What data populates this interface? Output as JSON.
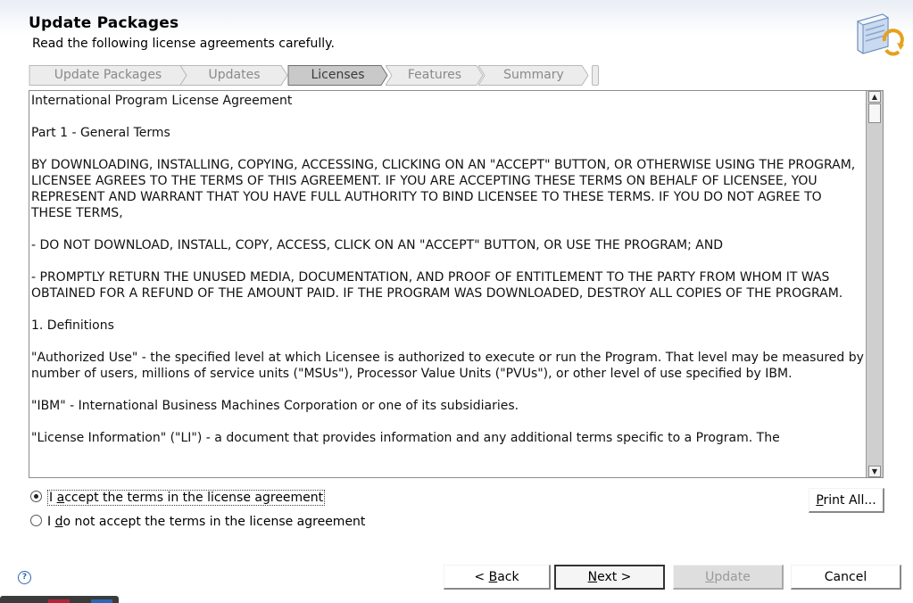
{
  "header": {
    "title": "Update Packages",
    "subtitle": "Read the following license agreements carefully."
  },
  "steps": [
    {
      "label": "Update Packages",
      "active": false
    },
    {
      "label": "Updates",
      "active": false
    },
    {
      "label": "Licenses",
      "active": true
    },
    {
      "label": "Features",
      "active": false
    },
    {
      "label": "Summary",
      "active": false
    }
  ],
  "license": {
    "text": "International Program License Agreement\n\nPart 1 - General Terms\n\nBY DOWNLOADING, INSTALLING, COPYING, ACCESSING, CLICKING ON AN \"ACCEPT\" BUTTON, OR OTHERWISE USING THE PROGRAM, LICENSEE AGREES TO THE TERMS OF THIS AGREEMENT. IF YOU ARE ACCEPTING THESE TERMS ON BEHALF OF LICENSEE, YOU REPRESENT AND WARRANT THAT YOU HAVE FULL AUTHORITY TO BIND LICENSEE TO THESE TERMS. IF YOU DO NOT AGREE TO THESE TERMS,\n\n- DO NOT DOWNLOAD, INSTALL, COPY, ACCESS, CLICK ON AN \"ACCEPT\" BUTTON, OR USE THE PROGRAM; AND\n\n- PROMPTLY RETURN THE UNUSED MEDIA, DOCUMENTATION, AND PROOF OF ENTITLEMENT TO THE PARTY FROM WHOM IT WAS OBTAINED FOR A REFUND OF THE AMOUNT PAID. IF THE PROGRAM WAS DOWNLOADED, DESTROY ALL COPIES OF THE PROGRAM.\n\n1. Definitions\n\n\"Authorized Use\" - the specified level at which Licensee is authorized to execute or run the Program. That level may be measured by number of users, millions of service units (\"MSUs\"), Processor Value Units (\"PVUs\"), or other level of use specified by IBM.\n\n\"IBM\" - International Business Machines Corporation or one of its subsidiaries.\n\n\"License Information\" (\"LI\") - a document that provides information and any additional terms specific to a Program. The"
  },
  "options": {
    "accept": {
      "before": "I ",
      "mnemonic": "a",
      "after": "ccept the terms in the license agreement",
      "selected": true
    },
    "decline": {
      "before": "I ",
      "mnemonic": "d",
      "after": "o not accept the terms in the license agreement",
      "selected": false
    }
  },
  "buttons": {
    "print_all": {
      "mnemonic": "P",
      "rest": "rint All..."
    },
    "back": {
      "before": "< ",
      "mnemonic": "B",
      "rest": "ack"
    },
    "next": {
      "mnemonic": "N",
      "rest": "ext >"
    },
    "update": {
      "mnemonic": "U",
      "rest": "pdate",
      "enabled": false
    },
    "cancel": {
      "label": "Cancel"
    }
  },
  "help_icon": "question-icon",
  "colors": {
    "header_gradient_top": "#e9eef5",
    "step_bg": "#ececec",
    "step_active_bg": "#c9c9c9"
  }
}
